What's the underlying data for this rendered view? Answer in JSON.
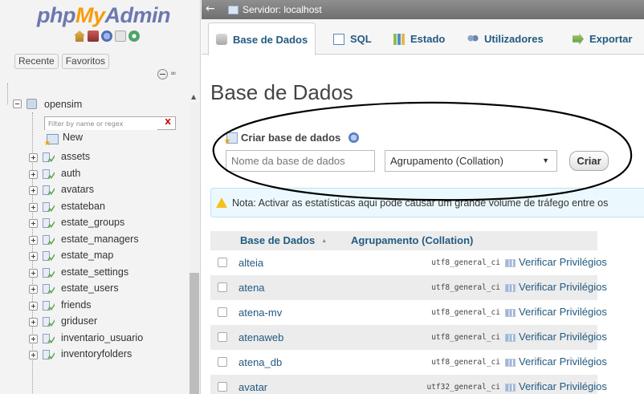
{
  "nav": {
    "logo": {
      "php": "php",
      "my": "My",
      "admin": "Admin"
    },
    "icons": [
      "home-icon",
      "database-icon",
      "docs-icon",
      "sql-query-icon",
      "settings-icon"
    ],
    "tabs": {
      "recent": "Recente",
      "favorites": "Favoritos"
    },
    "link_icon": "∞",
    "database": "opensim",
    "filter_placeholder": "Filter by name or regex",
    "filter_clear": "X",
    "new_label": "New",
    "tables": [
      "assets",
      "auth",
      "avatars",
      "estateban",
      "estate_groups",
      "estate_managers",
      "estate_map",
      "estate_settings",
      "estate_users",
      "friends",
      "griduser",
      "inventario_usuario",
      "inventoryfolders"
    ]
  },
  "topbar": {
    "back_arrow": "←",
    "server_label": "Servidor: localhost"
  },
  "tabs": [
    {
      "label": "Base de Dados",
      "icon": "database-icon",
      "active": true
    },
    {
      "label": "SQL",
      "icon": "sql-icon",
      "active": false
    },
    {
      "label": "Estado",
      "icon": "status-icon",
      "active": false
    },
    {
      "label": "Utilizadores",
      "icon": "users-icon",
      "active": false
    },
    {
      "label": "Exportar",
      "icon": "export-icon",
      "active": false
    }
  ],
  "main": {
    "title": "Base de Dados",
    "create": {
      "label": "Criar base de dados",
      "name_placeholder": "Nome da base de dados",
      "collation_selected": "Agrupamento (Collation)",
      "collation_arrow": "▼",
      "button": "Criar"
    },
    "notice": "Nota: Activar as estatísticas aqui pode causar um grande volume de tráfego entre os",
    "table": {
      "headers": {
        "database": "Base de Dados",
        "collation": "Agrupamento (Collation)",
        "sort_arrow": "▲"
      },
      "rows": [
        {
          "name": "alteia",
          "collation": "utf8_general_ci",
          "action": "Verificar Privilégios"
        },
        {
          "name": "atena",
          "collation": "utf8_general_ci",
          "action": "Verificar Privilégios"
        },
        {
          "name": "atena-mv",
          "collation": "utf8_general_ci",
          "action": "Verificar Privilégios"
        },
        {
          "name": "atenaweb",
          "collation": "utf8_general_ci",
          "action": "Verificar Privilégios"
        },
        {
          "name": "atena_db",
          "collation": "utf8_general_ci",
          "action": "Verificar Privilégios"
        },
        {
          "name": "avatar",
          "collation": "utf32_general_ci",
          "action": "Verificar Privilégios"
        }
      ]
    }
  },
  "colors": {
    "link": "#235a81",
    "logo_blue": "#6c78af",
    "logo_orange": "#f89c0e",
    "notice_bg": "#ebf8fd",
    "topbar": "#7f7f7f"
  }
}
